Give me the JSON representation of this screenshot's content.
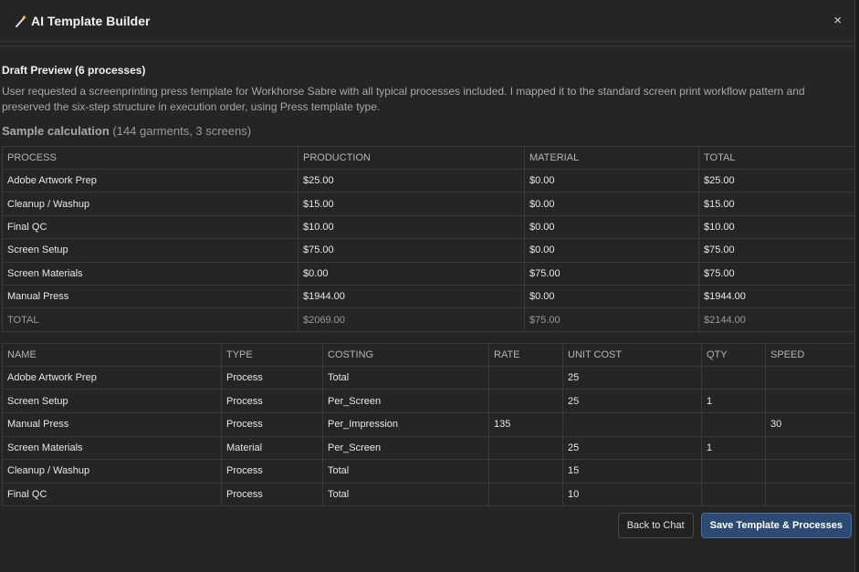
{
  "modal": {
    "title": "AI Template Builder",
    "close_symbol": "×"
  },
  "draft": {
    "heading": "Draft Preview (6 processes)",
    "summary": "User requested a screenprinting press template for Workhorse Sabre with all typical processes included. I mapped it to the standard screen print workflow pattern and preserved the six-step structure in execution order, using Press template type.",
    "sample_label": "Sample calculation",
    "sample_detail": "(144 garments, 3 screens)"
  },
  "calc_table": {
    "headers": [
      "PROCESS",
      "PRODUCTION",
      "MATERIAL",
      "TOTAL"
    ],
    "rows": [
      [
        "Adobe Artwork Prep",
        "$25.00",
        "$0.00",
        "$25.00"
      ],
      [
        "Cleanup / Washup",
        "$15.00",
        "$0.00",
        "$15.00"
      ],
      [
        "Final QC",
        "$10.00",
        "$0.00",
        "$10.00"
      ],
      [
        "Screen Setup",
        "$75.00",
        "$0.00",
        "$75.00"
      ],
      [
        "Screen Materials",
        "$0.00",
        "$75.00",
        "$75.00"
      ],
      [
        "Manual Press",
        "$1944.00",
        "$0.00",
        "$1944.00"
      ],
      [
        "TOTAL",
        "$2069.00",
        "$75.00",
        "$2144.00"
      ]
    ]
  },
  "detail_table": {
    "headers": [
      "NAME",
      "TYPE",
      "COSTING",
      "RATE",
      "UNIT COST",
      "QTY",
      "SPEED"
    ],
    "rows": [
      [
        "Adobe Artwork Prep",
        "Process",
        "Total",
        "",
        "25",
        "",
        ""
      ],
      [
        "Screen Setup",
        "Process",
        "Per_Screen",
        "",
        "25",
        "1",
        ""
      ],
      [
        "Manual Press",
        "Process",
        "Per_Impression",
        "135",
        "",
        "",
        "30"
      ],
      [
        "Screen Materials",
        "Material",
        "Per_Screen",
        "",
        "25",
        "1",
        ""
      ],
      [
        "Cleanup / Washup",
        "Process",
        "Total",
        "",
        "15",
        "",
        ""
      ],
      [
        "Final QC",
        "Process",
        "Total",
        "",
        "10",
        "",
        ""
      ]
    ]
  },
  "footer": {
    "back_label": "Back to Chat",
    "save_label": "Save Template & Processes"
  }
}
